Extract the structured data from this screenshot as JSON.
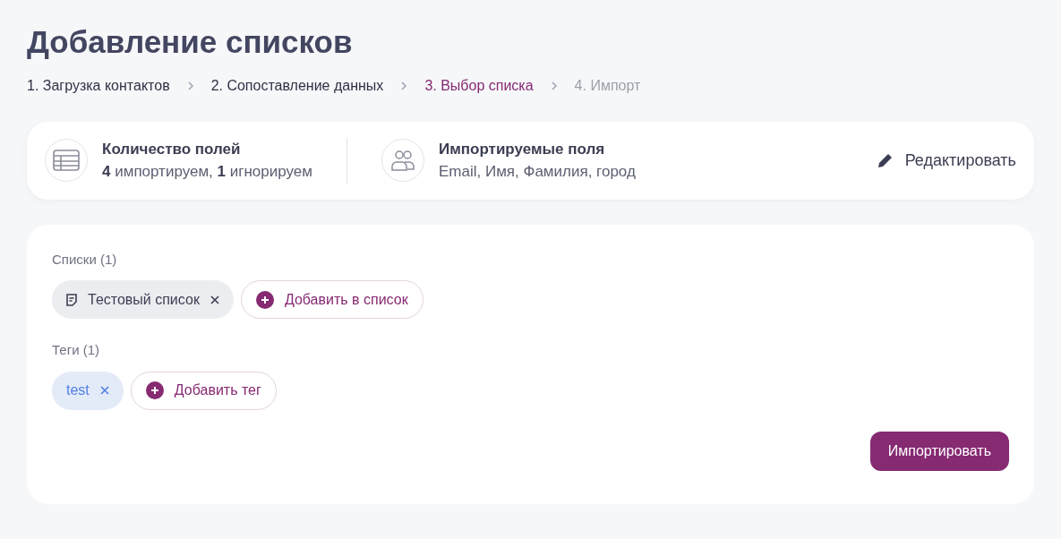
{
  "title": "Добавление списков",
  "steps": [
    {
      "label": "1. Загрузка контактов",
      "selected": false,
      "disabled": false
    },
    {
      "label": "2. Сопоставление данных",
      "selected": false,
      "disabled": false
    },
    {
      "label": "3. Выбор списка",
      "selected": true,
      "disabled": false
    },
    {
      "label": "4. Импорт",
      "selected": false,
      "disabled": true
    }
  ],
  "summary": [
    {
      "kind": "table",
      "title": "Количество полей",
      "text": "**4** импортируем, **1** игнорируем"
    },
    {
      "kind": "people",
      "title": "Импортируемые поля",
      "text": "Email, Имя, Фамилия, город"
    }
  ],
  "edit_button": "Редактировать",
  "groups": [
    {
      "kind": "list",
      "label": "Списки (1)",
      "chips": [
        "Тестовый список"
      ],
      "add_button": "Добавить в список"
    },
    {
      "kind": "tag",
      "label": "Теги (1)",
      "chips": [
        "test"
      ],
      "add_button": "Добавить тег"
    }
  ],
  "import_button": "Импортировать"
}
